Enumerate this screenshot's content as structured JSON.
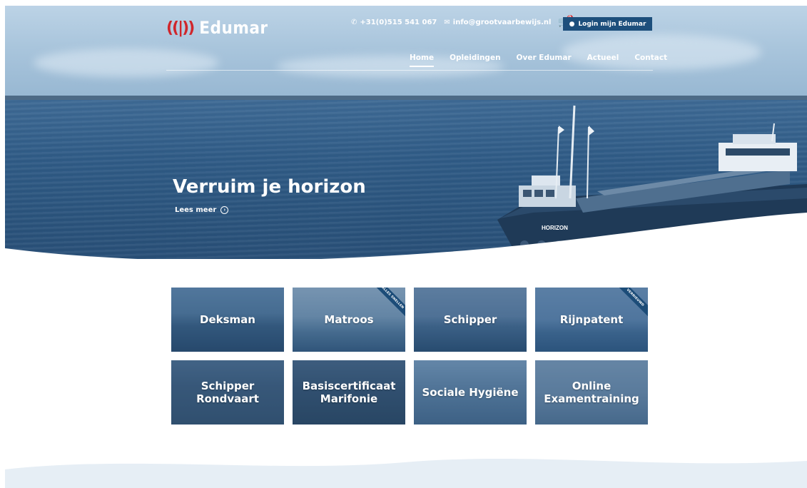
{
  "brand": {
    "logo_mark": "((|))",
    "name": "Edumar",
    "accent_color": "#d0262b",
    "primary_color": "#1d4f7c"
  },
  "topbar": {
    "phone_icon": "phone-icon",
    "phone": "+31(0)515 541 067",
    "email_icon": "mail-icon",
    "email": "info@grootvaarbewijs.nl",
    "cart_icon": "cart-icon",
    "cart_count": "0",
    "login_icon": "user-icon",
    "login_label": "Login mijn Edumar"
  },
  "nav": {
    "items": [
      {
        "label": "Home",
        "active": true
      },
      {
        "label": "Opleidingen",
        "active": false
      },
      {
        "label": "Over Edumar",
        "active": false
      },
      {
        "label": "Actueel",
        "active": false
      },
      {
        "label": "Contact",
        "active": false
      }
    ]
  },
  "hero": {
    "title": "Verruim je horizon",
    "link_label": "Lees meer",
    "link_icon": "arrow-circle-icon",
    "ship_name": "HORIZON"
  },
  "courses": [
    {
      "label": "Deksman",
      "ribbon": ""
    },
    {
      "label": "Matroos",
      "ribbon": "ALLES SNELLEN"
    },
    {
      "label": "Schipper",
      "ribbon": ""
    },
    {
      "label": "Rijnpatent",
      "ribbon": "VERNIEUWD"
    },
    {
      "label": "Schipper Rondvaart",
      "ribbon": ""
    },
    {
      "label": "Basiscertificaat Marifonie",
      "ribbon": ""
    },
    {
      "label": "Sociale Hygiëne",
      "ribbon": ""
    },
    {
      "label": "Online Examentraining",
      "ribbon": ""
    }
  ]
}
